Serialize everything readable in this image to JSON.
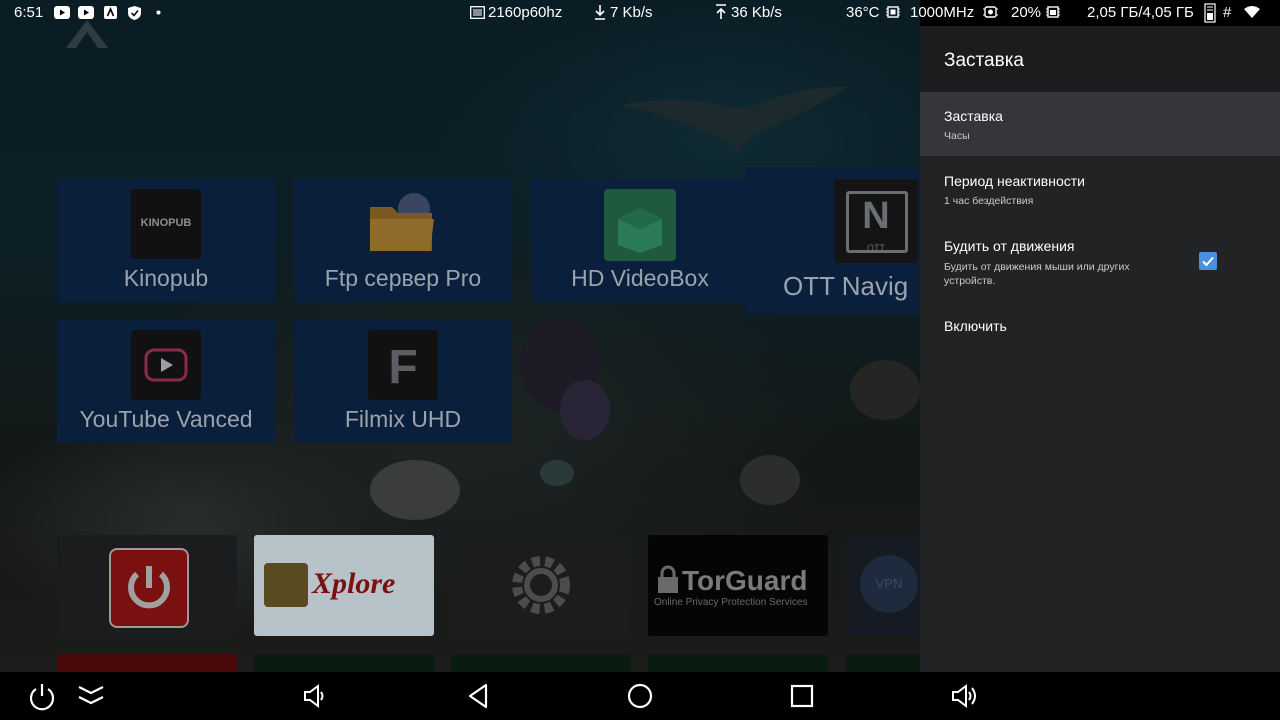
{
  "status_bar": {
    "time": "6:51",
    "resolution": "2160p60hz",
    "download": "7 Kb/s",
    "upload": "36 Kb/s",
    "temperature": "36°C",
    "cpu_freq": "1000MHz",
    "cpu_load": "20%",
    "memory": "2,05 ГБ/4,05 ГБ",
    "hash": "#",
    "icons": [
      "youtube-icon",
      "youtube-icon",
      "store-icon",
      "shield-icon",
      "dot-icon",
      "screen-icon",
      "download-arrow-icon",
      "upload-arrow-icon",
      "chip-icon",
      "gpu-icon",
      "memory-icon",
      "ram-icon",
      "wifi-icon"
    ]
  },
  "apps": [
    {
      "label": "Kinopub",
      "icon_text": "KINOPUB",
      "icon": "kinopub-icon"
    },
    {
      "label": "Ftp сервер Pro",
      "icon": "folder-icon"
    },
    {
      "label": "HD VideoBox",
      "icon": "videobox-icon"
    },
    {
      "label": "OTT Navig",
      "icon_text": "OTT",
      "icon": "ott-navigator-icon"
    },
    {
      "label": "YouTube Vanced",
      "icon": "play-icon"
    },
    {
      "label": "Filmix UHD",
      "icon_text": "F",
      "icon": "filmix-icon"
    }
  ],
  "dock": [
    {
      "name": "power-app-tile",
      "icon": "power-icon"
    },
    {
      "name": "xplore-tile",
      "text": "Xplore",
      "icon": "xplore-icon"
    },
    {
      "name": "settings-tile",
      "icon": "gear-icon"
    },
    {
      "name": "torguard-tile",
      "text": "TorGuard",
      "subtext": "Online Privacy Protection Services",
      "icon": "torguard-icon"
    },
    {
      "name": "vpn-tile",
      "text": "VPN",
      "icon": "vpn-icon"
    }
  ],
  "settings": {
    "title": "Заставка",
    "items": [
      {
        "title": "Заставка",
        "subtitle": "Часы"
      },
      {
        "title": "Период неактивности",
        "subtitle": "1 час бездействия"
      },
      {
        "title": "Будить от движения",
        "subtitle": "Будить от движения мыши или других устройств.",
        "checked": true
      },
      {
        "title": "Включить"
      }
    ]
  },
  "nav": [
    "power-icon",
    "collapse-icon",
    "volume-down-icon",
    "back-icon",
    "home-icon",
    "recents-icon",
    "volume-up-icon"
  ],
  "colors": {
    "panel_bg": "#222325",
    "panel_head": "#1b1c1e",
    "checkbox": "#4a8fe0",
    "tile_bg": "#0a1f3c"
  }
}
